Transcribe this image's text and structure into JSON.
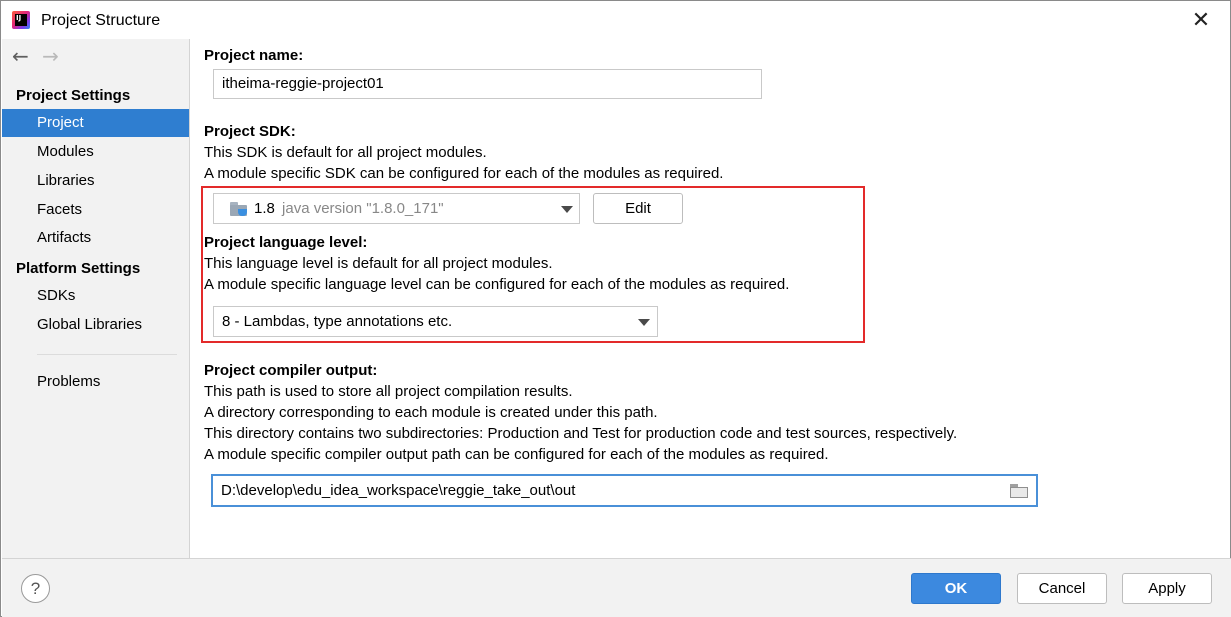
{
  "window": {
    "title": "Project Structure",
    "close_glyph": "✕",
    "app_icon_text": "IJ"
  },
  "nav": {
    "back_glyph": "←",
    "forward_glyph": "→"
  },
  "sidebar": {
    "project_settings_header": "Project Settings",
    "project_settings_items": [
      "Project",
      "Modules",
      "Libraries",
      "Facets",
      "Artifacts"
    ],
    "platform_settings_header": "Platform Settings",
    "platform_settings_items": [
      "SDKs",
      "Global Libraries"
    ],
    "problems_label": "Problems",
    "selected_item": "Project"
  },
  "main": {
    "project_name_label": "Project name:",
    "project_name_value": "itheima-reggie-project01",
    "sdk_label": "Project SDK:",
    "sdk_desc_1": "This SDK is default for all project modules.",
    "sdk_desc_2": "A module specific SDK can be configured for each of the modules as required.",
    "sdk_version": "1.8",
    "sdk_version_desc": "java version \"1.8.0_171\"",
    "sdk_edit_label": "Edit",
    "lang_label": "Project language level:",
    "lang_desc_1": "This language level is default for all project modules.",
    "lang_desc_2": "A module specific language level can be configured for each of the modules as required.",
    "lang_value": "8 - Lambdas, type annotations etc.",
    "out_label": "Project compiler output:",
    "out_desc_1": "This path is used to store all project compilation results.",
    "out_desc_2": "A directory corresponding to each module is created under this path.",
    "out_desc_3": "This directory contains two subdirectories: Production and Test for production code and test sources, respectively.",
    "out_desc_4": "A module specific compiler output path can be configured for each of the modules as required.",
    "out_value": "D:\\develop\\edu_idea_workspace\\reggie_take_out\\out"
  },
  "footer": {
    "help_glyph": "?",
    "ok_label": "OK",
    "cancel_label": "Cancel",
    "apply_label": "Apply"
  },
  "colors": {
    "selection": "#2f7ed0",
    "highlight_box": "#e32a2a",
    "primary_button": "#3c89df",
    "focus_border": "#4a90d8"
  },
  "icons": [
    "app-logo-icon",
    "close-icon",
    "back-arrow-icon",
    "forward-arrow-icon",
    "sdk-folder-icon",
    "chevron-down-icon",
    "browse-folder-icon",
    "help-icon"
  ]
}
